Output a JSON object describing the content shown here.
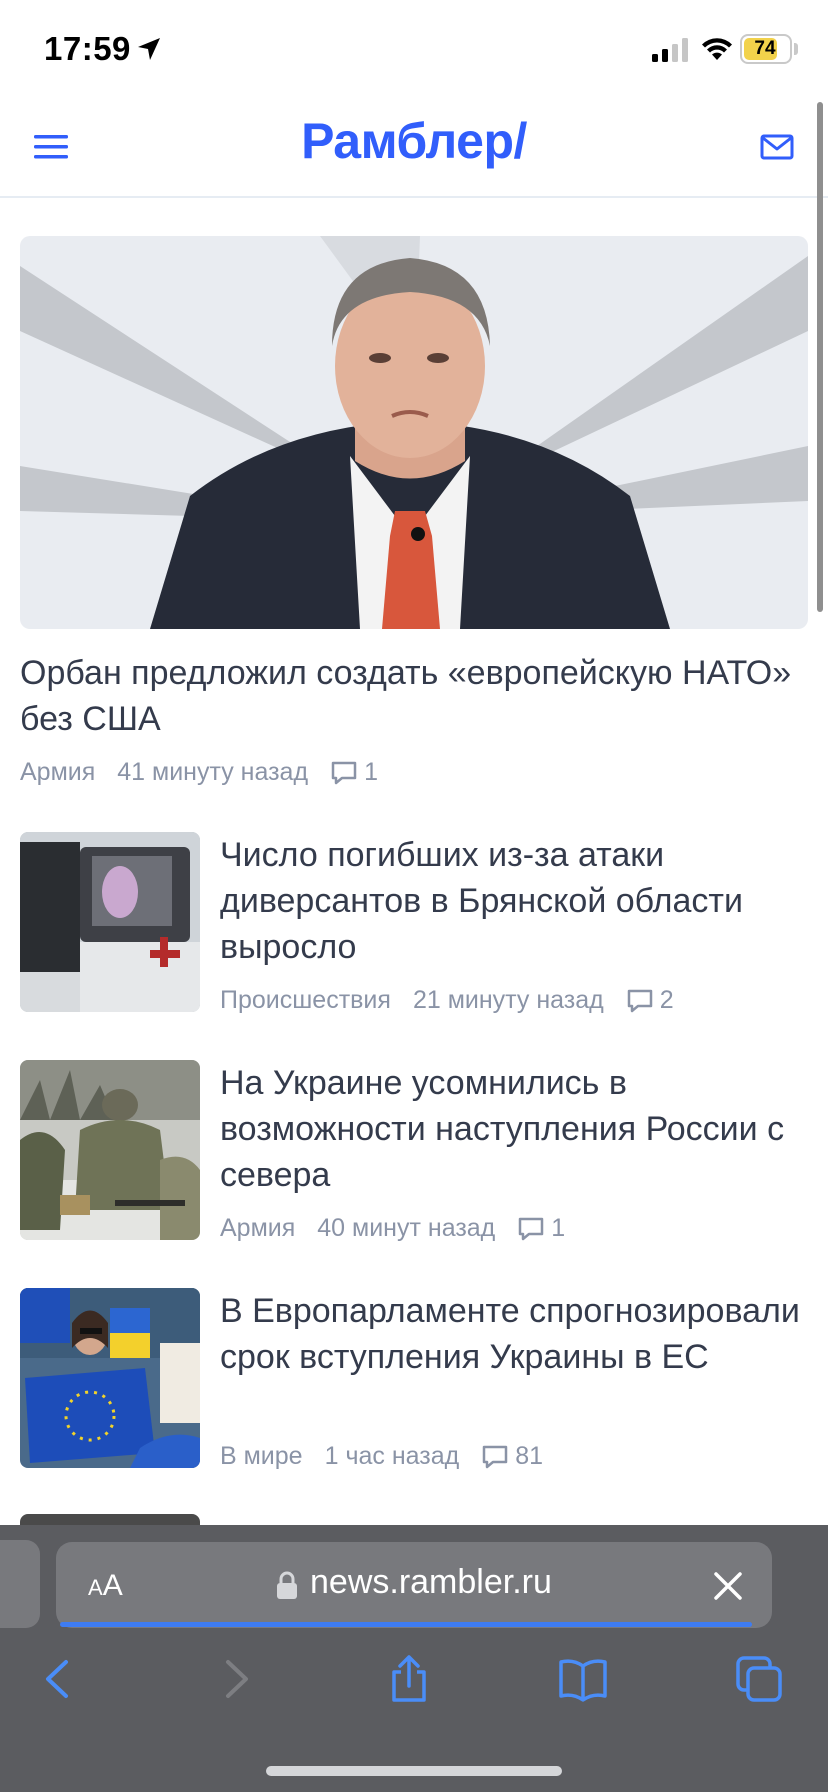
{
  "status_bar": {
    "time": "17:59",
    "battery": "74",
    "battery_level": 0.74,
    "icons": [
      "location-arrow-icon",
      "signal-icon",
      "wifi-icon",
      "battery-icon"
    ]
  },
  "header": {
    "logo": "Рамблер/",
    "menu_icon": "hamburger-menu-icon",
    "mail_icon": "mail-icon"
  },
  "colors": {
    "brand": "#315efb",
    "title_text": "#343b4c",
    "meta_text": "#8a93a6",
    "safari_bar": "#5b5c60",
    "progress": "#3e7cf3"
  },
  "hero": {
    "title": "Орбан предложил создать «европейскую НАТО» без США",
    "category": "Армия",
    "time": "41 минуту назад",
    "comments": "1"
  },
  "news": [
    {
      "title": "Число погибших из-за атаки диверсантов в Брянской области выросло",
      "category": "Происшествия",
      "time": "21 минуту назад",
      "comments": "2"
    },
    {
      "title": "На Украине усомнились в возможности наступления России с севера",
      "category": "Армия",
      "time": "40 минут назад",
      "comments": "1"
    },
    {
      "title": "В Европарламенте спрогнозировали срок вступления Украины в ЕС",
      "category": "В мире",
      "time": "1 час назад",
      "comments": "81"
    }
  ],
  "browser": {
    "text_size_label_small": "A",
    "text_size_label_large": "A",
    "url": "news.rambler.ru",
    "load_progress": 0.98,
    "toolbar_icons": [
      "back-icon",
      "forward-icon",
      "share-icon",
      "bookmarks-icon",
      "tabs-icon"
    ]
  }
}
